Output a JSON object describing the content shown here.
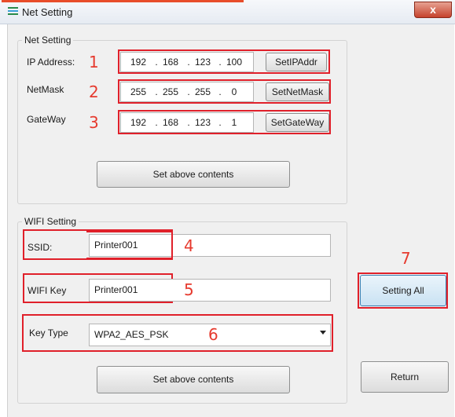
{
  "window": {
    "title": "Net Setting",
    "close_glyph": "x"
  },
  "net_setting": {
    "group_label": "Net Setting",
    "ip": {
      "label": "IP Address:",
      "octets": [
        "192",
        "168",
        "123",
        "100"
      ],
      "button": "SetIPAddr",
      "marker": "1"
    },
    "mask": {
      "label": "NetMask",
      "octets": [
        "255",
        "255",
        "255",
        "0"
      ],
      "button": "SetNetMask",
      "marker": "2"
    },
    "gateway": {
      "label": "GateWay",
      "octets": [
        "192",
        "168",
        "123",
        "1"
      ],
      "button": "SetGateWay",
      "marker": "3"
    },
    "set_button": "Set above contents",
    "dot": "."
  },
  "wifi_setting": {
    "group_label": "WIFI Setting",
    "ssid": {
      "label": "SSID:",
      "value": "Printer001",
      "marker": "4"
    },
    "key": {
      "label": "WIFI Key",
      "value": "Printer001",
      "marker": "5"
    },
    "key_type": {
      "label": "Key Type",
      "value": "WPA2_AES_PSK",
      "marker": "6"
    },
    "set_button": "Set above contents"
  },
  "side": {
    "setting_all": "Setting All",
    "setting_all_marker": "7",
    "return": "Return"
  },
  "colors": {
    "annotation_red": "#e0202a",
    "close_red": "#c5432d"
  }
}
